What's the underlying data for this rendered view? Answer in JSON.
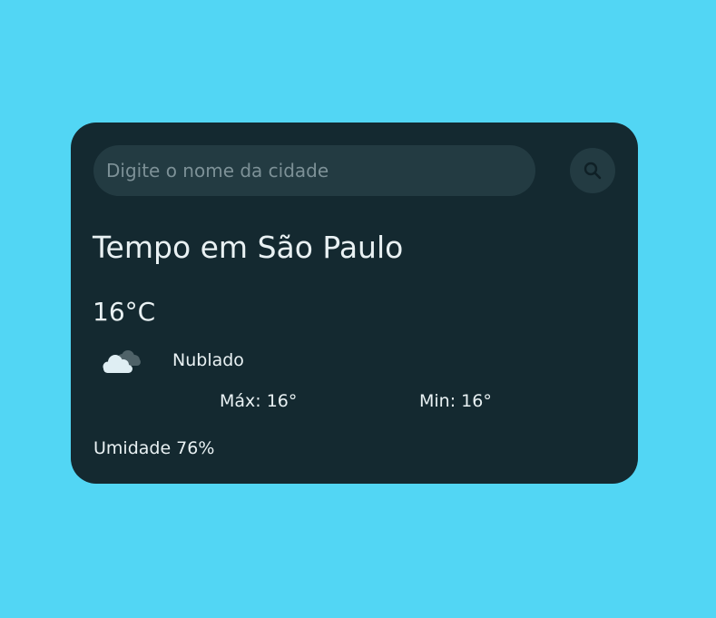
{
  "search": {
    "placeholder": "Digite o nome da cidade",
    "value": ""
  },
  "search_button": {
    "icon": "search-icon"
  },
  "weather": {
    "title": "Tempo em São Paulo",
    "temperature": "16°C",
    "icon": "cloud-icon",
    "description": "Nublado",
    "max": "Máx: 16°",
    "min": "Min: 16°",
    "humidity": "Umidade 76%"
  },
  "colors": {
    "background": "#52d6f4",
    "card": "#142930",
    "input": "#233b42",
    "text": "#e9f1f3"
  }
}
